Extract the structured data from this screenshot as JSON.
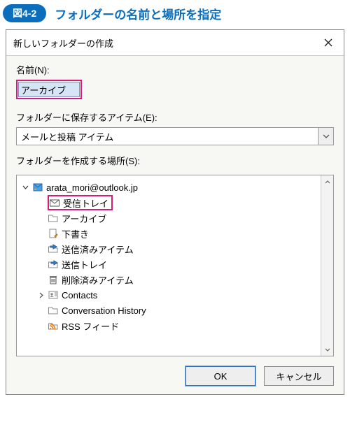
{
  "figure": {
    "badge": "図4-2",
    "caption": "フォルダーの名前と場所を指定"
  },
  "dialog": {
    "title": "新しいフォルダーの作成",
    "name_label": "名前(N):",
    "name_value": "アーカイブ",
    "contains_label": "フォルダーに保存するアイテム(E):",
    "contains_value": "メールと投稿 アイテム",
    "location_label": "フォルダーを作成する場所(S):",
    "ok_label": "OK",
    "cancel_label": "キャンセル"
  },
  "tree": {
    "root": "arata_mori@outlook.jp",
    "items": [
      {
        "label": "受信トレイ",
        "icon": "envelope",
        "highlight": true
      },
      {
        "label": "アーカイブ",
        "icon": "folder"
      },
      {
        "label": "下書き",
        "icon": "draft"
      },
      {
        "label": "送信済みアイテム",
        "icon": "sent"
      },
      {
        "label": "送信トレイ",
        "icon": "outbox"
      },
      {
        "label": "削除済みアイテム",
        "icon": "trash"
      },
      {
        "label": "Contacts",
        "icon": "contacts",
        "expandable": true
      },
      {
        "label": "Conversation History",
        "icon": "folder"
      },
      {
        "label": "RSS フィード",
        "icon": "rss"
      }
    ]
  }
}
